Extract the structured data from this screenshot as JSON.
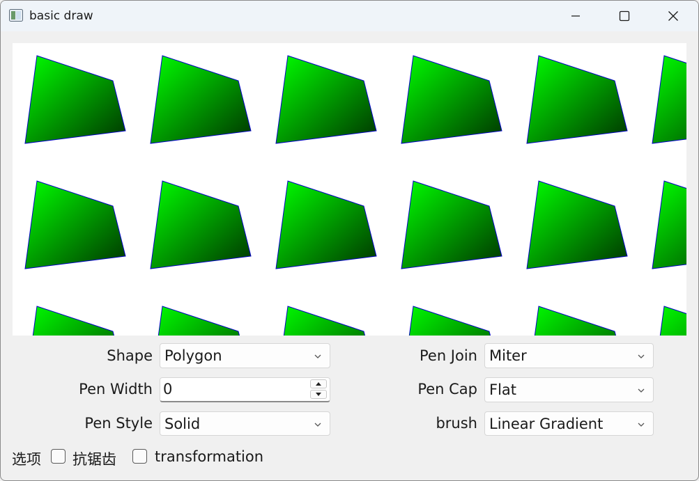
{
  "window": {
    "title": "basic draw",
    "icons": {
      "app": "window-app-icon",
      "minimize": "minimize-icon",
      "maximize": "maximize-icon",
      "close": "close-icon"
    }
  },
  "canvas": {
    "shape": "polygon",
    "stroke_color": "#0000c8",
    "gradient_start": "#00ff00",
    "gradient_end": "#003300"
  },
  "controls": {
    "shape": {
      "label": "Shape",
      "value": "Polygon"
    },
    "pen_width": {
      "label": "Pen Width",
      "value": "0"
    },
    "pen_style": {
      "label": "Pen Style",
      "value": "Solid"
    },
    "pen_join": {
      "label": "Pen Join",
      "value": "Miter"
    },
    "pen_cap": {
      "label": "Pen Cap",
      "value": "Flat"
    },
    "brush": {
      "label": "brush",
      "value": "Linear Gradient"
    }
  },
  "options": {
    "label": "选项",
    "antialiasing": {
      "label": "抗锯齿",
      "checked": false
    },
    "transformation": {
      "label": "transformation",
      "checked": false
    }
  }
}
